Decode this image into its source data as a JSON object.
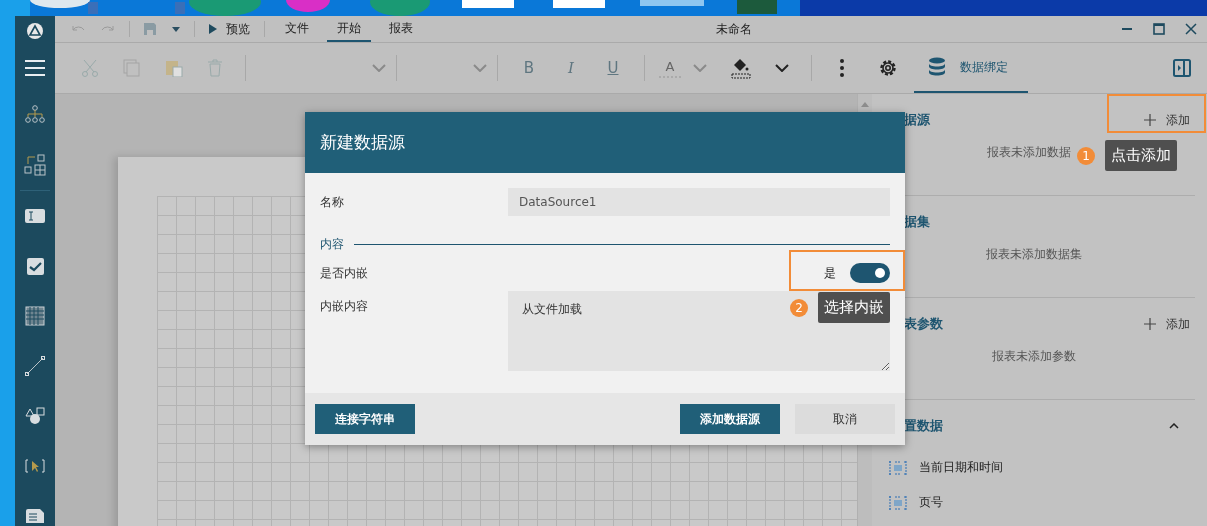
{
  "window": {
    "title": "未命名"
  },
  "quick_toolbar": {
    "preview": "预览"
  },
  "tabs": [
    {
      "label": "文件",
      "selected": false
    },
    {
      "label": "开始",
      "selected": true
    },
    {
      "label": "报表",
      "selected": false
    }
  ],
  "ribbon": {
    "format_buttons": [
      "B",
      "I",
      "U"
    ],
    "font_color_glyph": "A",
    "data_binding": {
      "label": "数据绑定",
      "selected": true
    }
  },
  "dialog": {
    "title": "新建数据源",
    "name_label": "名称",
    "name_value": "DataSource1",
    "section": "内容",
    "embed_label": "是否内嵌",
    "embed_state_text": "是",
    "embed": true,
    "content_label": "内嵌内容",
    "content_value": "从文件加载",
    "buttons": [
      {
        "label": "连接字符串",
        "kind": "primary"
      },
      {
        "label": "添加数据源",
        "kind": "primary"
      },
      {
        "label": "取消",
        "kind": "secondary"
      }
    ]
  },
  "panel": {
    "sections": [
      {
        "title": "据源",
        "add": "添加",
        "empty": "报表未添加数据"
      },
      {
        "title": "据集",
        "empty": "报表未添加数据集"
      },
      {
        "title": "表参数",
        "add": "添加",
        "empty": "报表未添加参数"
      }
    ],
    "builtin": {
      "title": "置数据",
      "expanded": true,
      "items": [
        "当前日期和时间",
        "页号"
      ]
    }
  },
  "callouts": [
    {
      "number": "1",
      "text": "点击添加"
    },
    {
      "number": "2",
      "text": "选择内嵌"
    }
  ]
}
